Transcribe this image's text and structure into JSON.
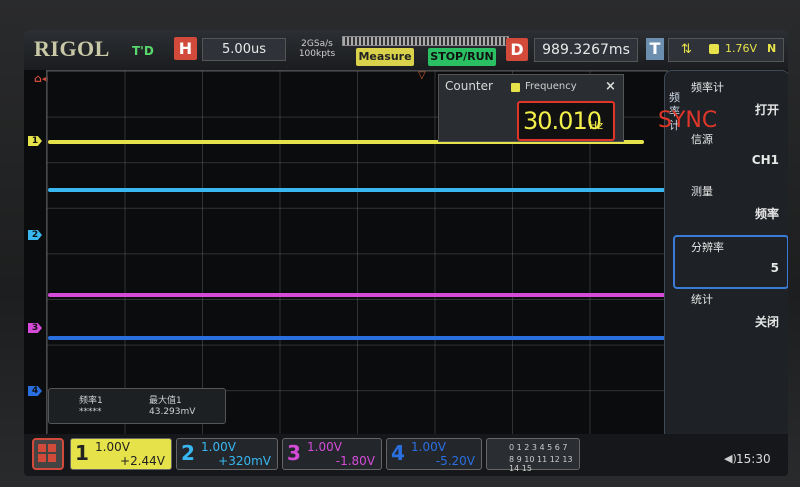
{
  "header": {
    "logo": "RIGOL",
    "run_state": "T'D",
    "horizontal_label": "H",
    "timebase": "5.00us",
    "sample_rate": "2GSa/s",
    "memory_depth": "100kpts",
    "measure_button": "Measure",
    "stop_run_button": "STOP/RUN",
    "delay_label": "D",
    "delay_value": "989.3267ms",
    "trigger_label": "T",
    "trigger_icon": "trigger-edge-icon",
    "trigger_level": "1.76V",
    "trigger_mode": "N"
  },
  "counter": {
    "title": "Counter",
    "type": "Frequency",
    "close": "×",
    "value": "30.010",
    "unit": "Hz"
  },
  "annotation": {
    "text": "SYNC",
    "color": "#e0362a"
  },
  "menu": {
    "side_title": "频率计",
    "items": [
      {
        "title": "频率计",
        "value": "打开"
      },
      {
        "title": "信源",
        "value": "CH1"
      },
      {
        "title": "测量",
        "value": "频率"
      },
      {
        "title": "分辨率",
        "value": "5"
      },
      {
        "title": "统计",
        "value": "关闭"
      }
    ]
  },
  "stats": {
    "h1": "频率1",
    "h2": "最大值1",
    "v1": "*****",
    "v2": "43.293mV"
  },
  "channels": [
    {
      "num": "1",
      "scale": "1.00V",
      "offset": "+2.44V",
      "color": "#e6e24a"
    },
    {
      "num": "2",
      "scale": "1.00V",
      "offset": "+320mV",
      "color": "#38b7f0"
    },
    {
      "num": "3",
      "scale": "1.00V",
      "offset": "-1.80V",
      "color": "#d54bd8"
    },
    {
      "num": "4",
      "scale": "1.00V",
      "offset": "-5.20V",
      "color": "#2a6fe0"
    }
  ],
  "digital": {
    "row1": "0 1 2 3 4 5 6 7",
    "row2": "8 9 10 11 12 13 14 15"
  },
  "clock": "15:30"
}
